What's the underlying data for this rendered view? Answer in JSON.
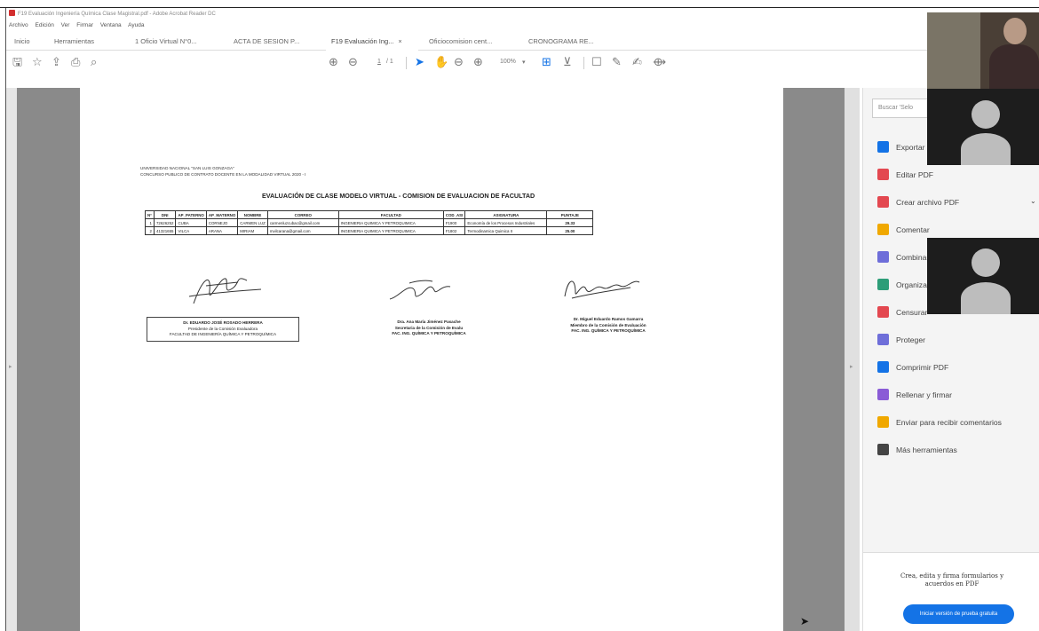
{
  "window": {
    "title": "F19 Evaluación Ingeniería Química Clase Magistral.pdf - Adobe Acrobat Reader DC",
    "menu": [
      "Archivo",
      "Edición",
      "Ver",
      "Firmar",
      "Ventana",
      "Ayuda"
    ]
  },
  "tabs": {
    "home": "Inicio",
    "tools": "Herramientas",
    "docs": [
      {
        "label": "1 Oficio Virtual N°0...",
        "active": false
      },
      {
        "label": "ACTA DE SESION P...",
        "active": false
      },
      {
        "label": "F19 Evaluación Ing...",
        "active": true,
        "close": "×"
      },
      {
        "label": "Oficiocomision cent...",
        "active": false
      },
      {
        "label": "CRONOGRAMA RE...",
        "active": false
      }
    ]
  },
  "toolbar": {
    "page_current": "1",
    "page_total": "/ 1",
    "zoom": "100%"
  },
  "document": {
    "university": "UNIVERSIDAD NACIONAL \"SAN LUIS GONZAGA\"",
    "contest": "CONCURSO PUBLICO DE CONTRATO DOCENTE EN LA MODALIDAD VIRTUAL 2020 - I",
    "heading": "EVALUACIÓN DE CLASE MODELO VIRTUAL - COMISION DE EVALUACION DE FACULTAD",
    "table": {
      "headers": [
        "N°",
        "DNI",
        "AP_PATERNO",
        "AP_MATERNO",
        "NOMBRE",
        "CORREO",
        "FACULTAD",
        "COD_ASI",
        "ASIGNATURA",
        "PUNTAJE"
      ],
      "rows": [
        [
          "1",
          "72626252",
          "CUBA",
          "CORNEJO",
          "CARMEN LUZ",
          "carmenluzcubac@gmail.com",
          "INGENIERIA QUIMICA Y PETROQUIMICA",
          "F1900",
          "Economía de los Procesos Industriales",
          "29.33"
        ],
        [
          "2",
          "41321655",
          "VILCA",
          "ARANA",
          "MIRIAM",
          "mvilcarana@gmail.com",
          "INGENIERIA QUIMICA Y PETROQUIMICA",
          "F1802",
          "Termodinamica Quimica II",
          "25.00"
        ]
      ]
    },
    "signatories": [
      {
        "name": "Dr. EDUARDO JOSÉ ROSADO HERRERA",
        "role": "Presidente de la Comisión Evaluadora",
        "faculty": "FACULTAD DE INGENIERÍA QUÍMICA Y PETROQUÍMICA"
      },
      {
        "name": "Dra. Ana María Jiménez Pasache",
        "role": "Secretaria de la Comisión de Evalu",
        "faculty": "FAC. ING. QUÍMICA Y PETROQUÍMICA"
      },
      {
        "name": "Dr. Miguel Eduardo Ramos Gamarra",
        "role": "Miembro de la Comisión de Evaluación",
        "faculty": "FAC. ING. QUÍMICA Y PETROQUÍMICA"
      }
    ]
  },
  "tools_pane": {
    "search_placeholder": "Buscar 'Selo",
    "items": [
      {
        "label": "Exportar",
        "icon": "export-pdf-icon",
        "color": "#1473e6"
      },
      {
        "label": "Editar PDF",
        "icon": "edit-pdf-icon",
        "color": "#e34850"
      },
      {
        "label": "Crear archivo PDF",
        "icon": "create-pdf-icon",
        "color": "#e34850"
      },
      {
        "label": "Comentar",
        "icon": "comment-icon",
        "color": "#f0a800"
      },
      {
        "label": "Combinar",
        "icon": "combine-icon",
        "color": "#6e6ed9"
      },
      {
        "label": "Organizar",
        "icon": "organize-icon",
        "color": "#2d9d78"
      },
      {
        "label": "Censurar",
        "icon": "redact-icon",
        "color": "#e34850"
      },
      {
        "label": "Proteger",
        "icon": "protect-icon",
        "color": "#6e6ed9"
      },
      {
        "label": "Comprimir PDF",
        "icon": "compress-icon",
        "color": "#1473e6"
      },
      {
        "label": "Rellenar y firmar",
        "icon": "fill-sign-icon",
        "color": "#8a5bd6"
      },
      {
        "label": "Enviar para recibir comentarios",
        "icon": "send-comments-icon",
        "color": "#f0a800"
      },
      {
        "label": "Más herramientas",
        "icon": "more-tools-icon",
        "color": "#444444"
      }
    ],
    "promo_text": "Crea, edita y firma formularios y acuerdos en PDF",
    "promo_button": "Iniciar versión de prueba gratuita"
  }
}
